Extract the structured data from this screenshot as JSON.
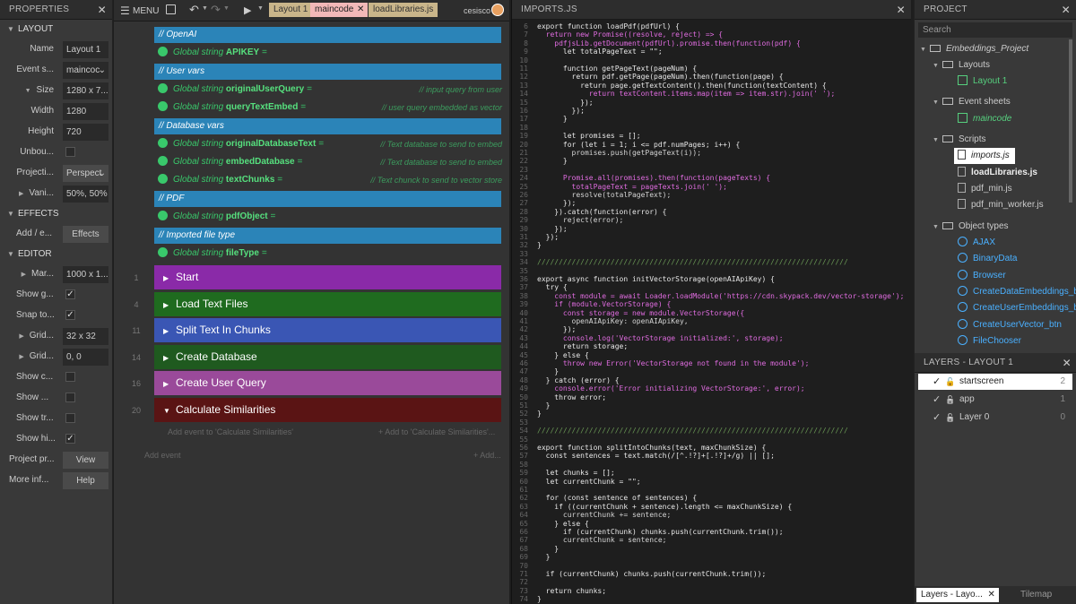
{
  "left": {
    "title": "PROPERTIES",
    "layout_section": "LAYOUT",
    "name_label": "Name",
    "name_value": "Layout 1",
    "eventsheet_label": "Event s...",
    "eventsheet_value": "maincoc",
    "size_label": "Size",
    "size_value": "1280 x 7...",
    "width_label": "Width",
    "width_value": "1280",
    "height_label": "Height",
    "height_value": "720",
    "unbounded_label": "Unbou...",
    "projection_label": "Projecti...",
    "projection_value": "Perspect",
    "vanish_label": "Vani...",
    "vanish_value": "50%, 50%",
    "effects_section": "EFFECTS",
    "addedit_label": "Add / e...",
    "effects_button": "Effects",
    "editor_section": "EDITOR",
    "margin_label": "Mar...",
    "margin_value": "1000 x 1...",
    "showgrid_label": "Show g...",
    "snapto_label": "Snap to...",
    "gridsize_label": "Grid...",
    "gridsize_value": "32 x 32",
    "gridoffset_label": "Grid...",
    "gridoffset_value": "0, 0",
    "showc_label": "Show c...",
    "show_label": "Show ...",
    "showtr_label": "Show tr...",
    "showhi_label": "Show hi...",
    "project_label": "Project pr...",
    "view_button": "View",
    "moreinfo_label": "More inf...",
    "help_button": "Help"
  },
  "toolbar": {
    "menu": "MENU",
    "tabs": [
      "Layout 1",
      "maincode",
      "loadLibraries.js"
    ],
    "user": "cesisco"
  },
  "events": {
    "groups": [
      {
        "label": "// OpenAI"
      },
      {
        "label": "// User vars"
      },
      {
        "label": "// Database vars"
      },
      {
        "label": "// PDF"
      },
      {
        "label": "// Imported file type"
      }
    ],
    "vars": [
      {
        "prefix": "Global string ",
        "name": "APIKEY",
        "suffix": " =",
        "comment": ""
      },
      {
        "prefix": "Global string ",
        "name": "originalUserQuery",
        "suffix": " =",
        "comment": "// input query from user"
      },
      {
        "prefix": "Global string ",
        "name": "queryTextEmbed",
        "suffix": " =",
        "comment": "// user query embedded as vector"
      },
      {
        "prefix": "Global string ",
        "name": "originalDatabaseText",
        "suffix": " =",
        "comment": "// Text database to send to embed"
      },
      {
        "prefix": "Global string ",
        "name": "embedDatabase",
        "suffix": " =",
        "comment": "// Text database to send to embed"
      },
      {
        "prefix": "Global string ",
        "name": "textChunks",
        "suffix": " =",
        "comment": "// Text chunck to send to vector store"
      },
      {
        "prefix": "Global string ",
        "name": "pdfObject",
        "suffix": " =",
        "comment": ""
      },
      {
        "prefix": "Global string ",
        "name": "fileType",
        "suffix": " =",
        "comment": ""
      }
    ],
    "blocks": [
      {
        "num": "1",
        "label": "Start",
        "color": "#8a2aa8"
      },
      {
        "num": "4",
        "label": "Load Text Files",
        "color": "#1f6b1f"
      },
      {
        "num": "11",
        "label": "Split Text In Chunks",
        "color": "#3a56b4"
      },
      {
        "num": "14",
        "label": "Create Database",
        "color": "#1f5a1f"
      },
      {
        "num": "16",
        "label": "Create User Query",
        "color": "#9a4a9a"
      },
      {
        "num": "20",
        "label": "Calculate Similarities",
        "color": "#5a1414"
      }
    ],
    "add_event_to": "Add event to 'Calculate Similarities'",
    "add_to": "+ Add to 'Calculate Similarities'...",
    "add_event": "Add event",
    "add": "+ Add..."
  },
  "code": {
    "title": "IMPORTS.JS",
    "lines": [
      [
        "6",
        "export function loadPdf(pdfUrl) {"
      ],
      [
        "7",
        "  return new Promise((resolve, reject) => {"
      ],
      [
        "8",
        "    pdfjsLib.getDocument(pdfUrl).promise.then(function(pdf) {"
      ],
      [
        "9",
        "      let totalPageText = \"\";"
      ],
      [
        "10",
        ""
      ],
      [
        "11",
        "      function getPageText(pageNum) {"
      ],
      [
        "12",
        "        return pdf.getPage(pageNum).then(function(page) {"
      ],
      [
        "13",
        "          return page.getTextContent().then(function(textContent) {"
      ],
      [
        "14",
        "            return textContent.items.map(item => item.str).join(' ');"
      ],
      [
        "15",
        "          });"
      ],
      [
        "16",
        "        });"
      ],
      [
        "17",
        "      }"
      ],
      [
        "18",
        ""
      ],
      [
        "19",
        "      let promises = [];"
      ],
      [
        "20",
        "      for (let i = 1; i <= pdf.numPages; i++) {"
      ],
      [
        "21",
        "        promises.push(getPageText(i));"
      ],
      [
        "22",
        "      }"
      ],
      [
        "23",
        ""
      ],
      [
        "24",
        "      Promise.all(promises).then(function(pageTexts) {"
      ],
      [
        "25",
        "        totalPageText = pageTexts.join(' ');"
      ],
      [
        "26",
        "        resolve(totalPageText);"
      ],
      [
        "27",
        "      });"
      ],
      [
        "28",
        "    }).catch(function(error) {"
      ],
      [
        "29",
        "      reject(error);"
      ],
      [
        "30",
        "    });"
      ],
      [
        "31",
        "  });"
      ],
      [
        "32",
        "}"
      ],
      [
        "33",
        ""
      ],
      [
        "34",
        "////////////////////////////////////////////////////////////////////////"
      ],
      [
        "35",
        ""
      ],
      [
        "36",
        "export async function initVectorStorage(openAIApiKey) {"
      ],
      [
        "37",
        "  try {"
      ],
      [
        "38",
        "    const module = await Loader.loadModule('https://cdn.skypack.dev/vector-storage');"
      ],
      [
        "39",
        "    if (module.VectorStorage) {"
      ],
      [
        "40",
        "      const storage = new module.VectorStorage({"
      ],
      [
        "41",
        "        openAIApiKey: openAIApiKey,"
      ],
      [
        "42",
        "      });"
      ],
      [
        "43",
        "      console.log('VectorStorage initialized:', storage);"
      ],
      [
        "44",
        "      return storage;"
      ],
      [
        "45",
        "    } else {"
      ],
      [
        "46",
        "      throw new Error('VectorStorage not found in the module');"
      ],
      [
        "47",
        "    }"
      ],
      [
        "48",
        "  } catch (error) {"
      ],
      [
        "49",
        "    console.error('Error initializing VectorStorage:', error);"
      ],
      [
        "50",
        "    throw error;"
      ],
      [
        "51",
        "  }"
      ],
      [
        "52",
        "}"
      ],
      [
        "53",
        ""
      ],
      [
        "54",
        "////////////////////////////////////////////////////////////////////////"
      ],
      [
        "55",
        ""
      ],
      [
        "56",
        "export function splitIntoChunks(text, maxChunkSize) {"
      ],
      [
        "57",
        "  const sentences = text.match(/[^.!?]+[.!?]+/g) || [];"
      ],
      [
        "58",
        ""
      ],
      [
        "59",
        "  let chunks = [];"
      ],
      [
        "60",
        "  let currentChunk = \"\";"
      ],
      [
        "61",
        ""
      ],
      [
        "62",
        "  for (const sentence of sentences) {"
      ],
      [
        "63",
        "    if ((currentChunk + sentence).length <= maxChunkSize) {"
      ],
      [
        "64",
        "      currentChunk += sentence;"
      ],
      [
        "65",
        "    } else {"
      ],
      [
        "66",
        "      if (currentChunk) chunks.push(currentChunk.trim());"
      ],
      [
        "67",
        "      currentChunk = sentence;"
      ],
      [
        "68",
        "    }"
      ],
      [
        "69",
        "  }"
      ],
      [
        "70",
        ""
      ],
      [
        "71",
        "  if (currentChunk) chunks.push(currentChunk.trim());"
      ],
      [
        "72",
        ""
      ],
      [
        "73",
        "  return chunks;"
      ],
      [
        "74",
        "}"
      ]
    ]
  },
  "project": {
    "title": "PROJECT",
    "search_placeholder": "Search",
    "root": "Embeddings_Project",
    "layouts": "Layouts",
    "layout1": "Layout 1",
    "eventsheets": "Event sheets",
    "maincode": "maincode",
    "scripts": "Scripts",
    "script_files": [
      "imports.js",
      "loadLibraries.js",
      "pdf_min.js",
      "pdf_min_worker.js"
    ],
    "objecttypes": "Object types",
    "objects": [
      "AJAX",
      "BinaryData",
      "Browser",
      "CreateDataEmbeddings_btn",
      "CreateUserEmbeddings_btn",
      "CreateUserVector_btn",
      "FileChooser"
    ]
  },
  "layers": {
    "title": "LAYERS - LAYOUT 1",
    "items": [
      {
        "name": "startscreen",
        "num": "2"
      },
      {
        "name": "app",
        "num": "1"
      },
      {
        "name": "Layer 0",
        "num": "0"
      }
    ],
    "tab_layers": "Layers - Layo...",
    "tab_tilemap": "Tilemap"
  }
}
